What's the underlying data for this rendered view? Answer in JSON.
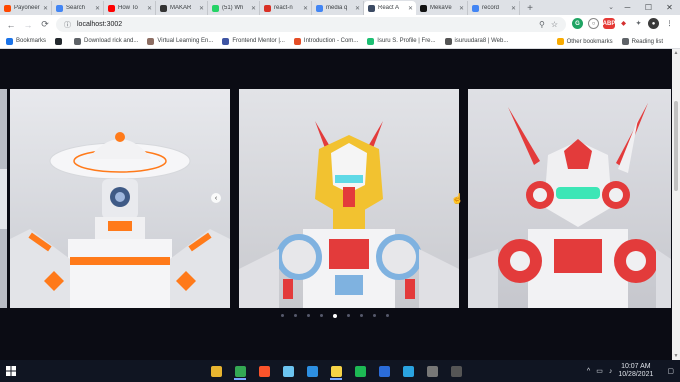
{
  "browser": {
    "tabs": [
      {
        "label": "Payoneer",
        "color": "#ff4800",
        "active": false
      },
      {
        "label": "Search",
        "color": "#4285f4",
        "active": false
      },
      {
        "label": "How To",
        "color": "#ff0000",
        "active": false
      },
      {
        "label": "MAKAR",
        "color": "#333333",
        "active": false
      },
      {
        "label": "(51) Wh",
        "color": "#25d366",
        "active": false
      },
      {
        "label": "react-n",
        "color": "#d93025",
        "active": false
      },
      {
        "label": "media q",
        "color": "#4285f4",
        "active": false
      },
      {
        "label": "React A",
        "color": "#3c4b64",
        "active": true
      },
      {
        "label": "MekaVe",
        "color": "#111111",
        "active": false
      },
      {
        "label": "record",
        "color": "#4285f4",
        "active": false
      }
    ],
    "new_tab_symbol": "+",
    "url": "localhost:3002",
    "bookmarks": [
      {
        "label": "Bookmarks",
        "icon": "star-icon",
        "color": "#1a73e8"
      },
      {
        "label": "",
        "icon": "github-icon",
        "color": "#24292e"
      },
      {
        "label": "Download rick and...",
        "icon": "globe-icon",
        "color": "#5f6368"
      },
      {
        "label": "Virtual Learning En...",
        "icon": "book-icon",
        "color": "#8d6e63"
      },
      {
        "label": "Frontend Mentor |...",
        "icon": "frontend-mentor-icon",
        "color": "#3e54a3"
      },
      {
        "label": "Introduction - Com...",
        "icon": "react-icon",
        "color": "#e44d26"
      },
      {
        "label": "Isuru S. Profile | Fre...",
        "icon": "profile-icon",
        "color": "#1dbf73"
      },
      {
        "label": "isuruudara8 | Web...",
        "icon": "web-icon",
        "color": "#555555"
      }
    ],
    "bookmarks_right": [
      {
        "label": "Other bookmarks",
        "icon": "folder-icon",
        "color": "#f9ab00"
      },
      {
        "label": "Reading list",
        "icon": "reading-list-icon",
        "color": "#5f6368"
      }
    ]
  },
  "slider": {
    "active_index": 4,
    "dot_count": 9,
    "slides": [
      {
        "name": "robot-white-hat",
        "palette": {
          "bg": "#d9dbe0",
          "main": "#f4f4f6",
          "accent": "#ff7a1a"
        }
      },
      {
        "name": "robot-yellow-gundam",
        "palette": {
          "bg": "#d6d7db",
          "main": "#f5f5f5",
          "accent": "#f2c230"
        }
      },
      {
        "name": "robot-red-gundam",
        "palette": {
          "bg": "#d3d4d9",
          "main": "#f0f0f2",
          "accent": "#e33b3b"
        }
      }
    ]
  },
  "taskbar": {
    "apps": [
      {
        "name": "file-explorer-icon",
        "color": "#e8b530",
        "glyph": ""
      },
      {
        "name": "chrome-icon",
        "color": "#34a853",
        "glyph": "",
        "open": true
      },
      {
        "name": "brave-icon",
        "color": "#fb542b",
        "glyph": ""
      },
      {
        "name": "notepad-icon",
        "color": "#6cc4f0",
        "glyph": ""
      },
      {
        "name": "vscode-icon",
        "color": "#2d8fe2",
        "glyph": ""
      },
      {
        "name": "sticky-notes-icon",
        "color": "#f7d447",
        "glyph": "",
        "open": true
      },
      {
        "name": "spotify-icon",
        "color": "#1db954",
        "glyph": ""
      },
      {
        "name": "mail-icon",
        "color": "#2b6cd9",
        "glyph": ""
      },
      {
        "name": "telegram-icon",
        "color": "#2aa3e0",
        "glyph": ""
      },
      {
        "name": "inkscape-icon",
        "color": "#777777",
        "glyph": ""
      },
      {
        "name": "obs-icon",
        "color": "#555555",
        "glyph": ""
      }
    ],
    "time": "10:07 AM",
    "date": "10/28/2021"
  }
}
